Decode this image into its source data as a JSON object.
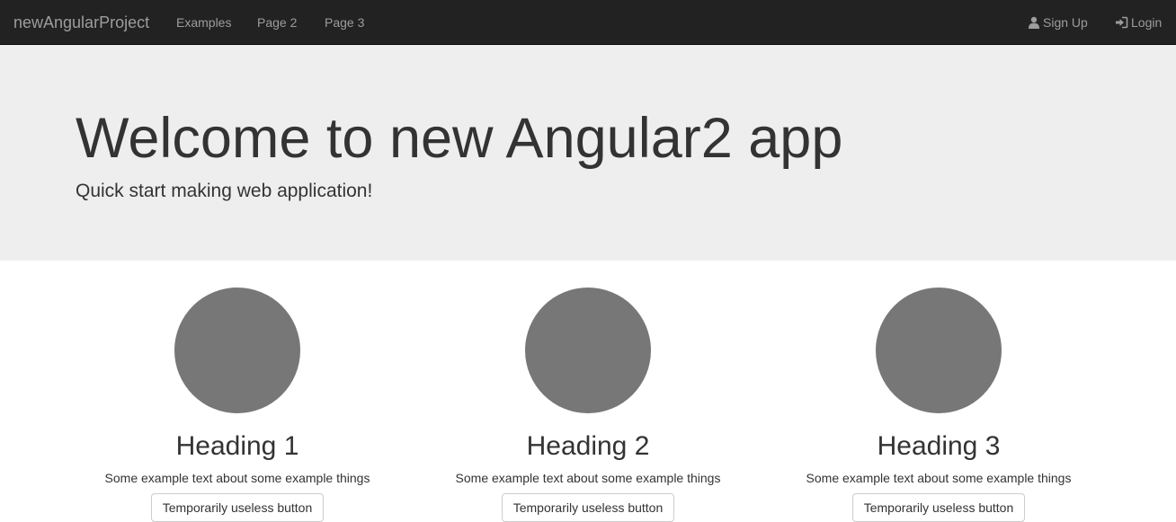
{
  "navbar": {
    "brand": "newAngularProject",
    "links": [
      "Examples",
      "Page 2",
      "Page 3"
    ],
    "signup_label": "Sign Up",
    "login_label": "Login",
    "background_color": "#222222",
    "link_color": "#9d9d9d"
  },
  "jumbotron": {
    "title": "Welcome to new Angular2 app",
    "subtitle": "Quick start making web application!",
    "background_color": "#eeeeee"
  },
  "columns": [
    {
      "heading": "Heading 1",
      "text": "Some example text about some example things",
      "button_label": "Temporarily useless button"
    },
    {
      "heading": "Heading 2",
      "text": "Some example text about some example things",
      "button_label": "Temporarily useless button"
    },
    {
      "heading": "Heading 3",
      "text": "Some example text about some example things",
      "button_label": "Temporarily useless button"
    }
  ],
  "colors": {
    "placeholder_circle": "#777777",
    "text": "#333333"
  },
  "icons": {
    "signup": "user-icon",
    "login": "login-icon"
  }
}
